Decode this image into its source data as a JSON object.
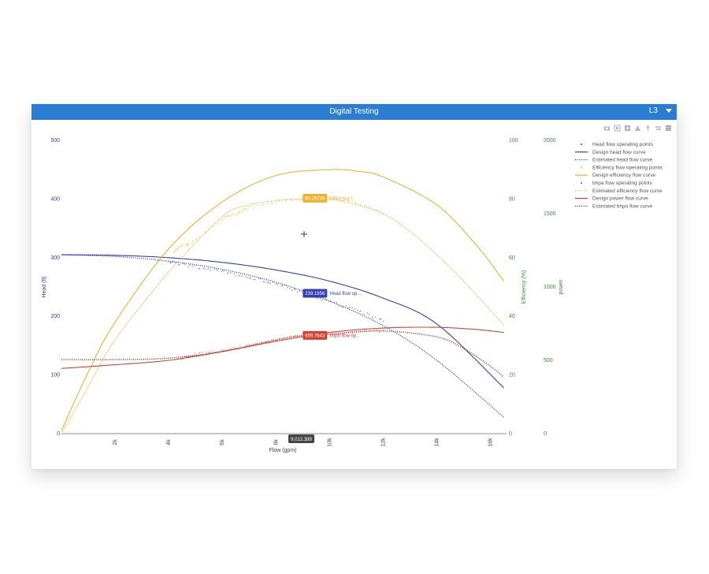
{
  "header": {
    "title": "Digital Testing",
    "selector_value": "L3"
  },
  "modebar": [
    "camera-icon",
    "zoom-icon",
    "pan-icon",
    "autoscale-icon",
    "spike-icon",
    "compare-icon",
    "menu-icon"
  ],
  "colors": {
    "header": "#2a7dd1",
    "blue": "#3340b0",
    "orange": "#f2b030",
    "red": "#d64232",
    "green": "#3d8a3d"
  },
  "cursor": {
    "x_readout": "9,012.389"
  },
  "chart_data": {
    "type": "line",
    "xlabel": "Flow (gpm)",
    "xlim": [
      0,
      16600
    ],
    "x_ticks": [
      "2k",
      "4k",
      "6k",
      "8k",
      "10k",
      "12k",
      "14k",
      "16k"
    ],
    "x_tick_values": [
      2000,
      4000,
      6000,
      8000,
      10000,
      12000,
      14000,
      16000
    ],
    "axes": {
      "head": {
        "label": "Head (ft)",
        "range": [
          0,
          500
        ],
        "ticks": [
          "0",
          "100",
          "200",
          "300",
          "400",
          "500"
        ],
        "tick_values": [
          0,
          100,
          200,
          300,
          400,
          500
        ]
      },
      "efficiency": {
        "label": "Efficiency (%)",
        "range": [
          0,
          100
        ],
        "ticks": [
          "0",
          "20",
          "40",
          "60",
          "80",
          "100"
        ],
        "tick_values": [
          0,
          20,
          40,
          60,
          80,
          100
        ]
      },
      "power": {
        "label": "power",
        "range": [
          0,
          2000
        ],
        "ticks": [
          "0",
          "500",
          "1000",
          "1500",
          "2000"
        ],
        "tick_values": [
          0,
          500,
          1000,
          1500,
          2000
        ]
      }
    },
    "legend_position": "top-right",
    "series": [
      {
        "name": "Head flow operating points",
        "axis": "head",
        "style": "markers",
        "color": "#3340b0",
        "x": [
          4000,
          5000,
          6000,
          7000,
          8000,
          9000,
          10000,
          11000,
          12000
        ],
        "y": [
          293,
          284,
          276,
          266,
          255,
          240,
          225,
          210,
          193
        ]
      },
      {
        "name": "Design head flow curve",
        "axis": "head",
        "style": "solid",
        "color": "#3340b0",
        "x": [
          0,
          2000,
          4000,
          6000,
          8000,
          10000,
          12000,
          14000,
          16500
        ],
        "y": [
          305,
          304,
          300,
          292,
          279,
          260,
          231,
          187,
          78
        ]
      },
      {
        "name": "Estimated head flow curve",
        "axis": "head",
        "style": "dotted",
        "color": "#3340b0",
        "x": [
          0,
          2000,
          4000,
          6000,
          8000,
          10000,
          12000,
          14000,
          16500
        ],
        "y": [
          305,
          302,
          294,
          280,
          258,
          226,
          184,
          125,
          28
        ]
      },
      {
        "name": "Efficiency flow operating points",
        "axis": "efficiency",
        "style": "markers",
        "color": "#f2b030",
        "x": [
          4200,
          4500,
          5000,
          6000,
          6500,
          7000,
          8000,
          9000,
          10000,
          11000,
          12000
        ],
        "y": [
          62,
          64,
          66,
          73,
          75,
          77,
          79,
          80,
          80,
          79,
          75
        ]
      },
      {
        "name": "Design efficiency flow curve",
        "axis": "efficiency",
        "style": "solid",
        "color": "#f2b030",
        "x": [
          0,
          1000,
          2000,
          4000,
          6000,
          8000,
          10000,
          11000,
          12000,
          14000,
          15500,
          16500
        ],
        "y": [
          1,
          21,
          38,
          63,
          79,
          88,
          90,
          89.5,
          87.5,
          78,
          64,
          52
        ]
      },
      {
        "name": "bhpa flow operating points",
        "axis": "power",
        "style": "markers",
        "color": "#d64232",
        "x": [
          4500,
          5000,
          6000,
          7000,
          8000,
          9000,
          10000,
          11000,
          12000
        ],
        "y": [
          515,
          540,
          570,
          600,
          640,
          668,
          680,
          690,
          700
        ]
      },
      {
        "name": "Estimated efficiency flow curve",
        "axis": "efficiency",
        "style": "dotted",
        "color": "#f2b030",
        "x": [
          0,
          1000,
          2000,
          4000,
          6000,
          7000,
          8000,
          9000,
          10000,
          11000,
          12000,
          13000,
          14000,
          15000,
          16500
        ],
        "y": [
          0,
          16,
          32,
          55,
          74,
          78,
          79.5,
          80,
          80,
          78,
          75,
          69,
          61,
          52,
          37
        ]
      },
      {
        "name": "Design power flow curve",
        "axis": "power",
        "style": "solid",
        "color": "#d64232",
        "x": [
          0,
          2000,
          4000,
          6000,
          8000,
          10000,
          12000,
          14000,
          15500,
          16500
        ],
        "y": [
          445,
          470,
          500,
          560,
          630,
          690,
          720,
          725,
          710,
          690
        ]
      },
      {
        "name": "Estimated bhpa flow curve",
        "axis": "power",
        "style": "dotted",
        "color": "#8b1a1a",
        "x": [
          0,
          2000,
          4000,
          6000,
          8000,
          9000,
          10000,
          12000,
          14000,
          15000,
          16000,
          16500
        ],
        "y": [
          505,
          505,
          515,
          560,
          640,
          670,
          680,
          700,
          660,
          580,
          460,
          385
        ]
      }
    ],
    "annotations": [
      {
        "label": "80.26239",
        "text": "Efficiency f...",
        "axis": "efficiency",
        "x": 9000,
        "y": 80.26,
        "color": "#f2b030"
      },
      {
        "label": "239.1856",
        "text": "Head flow op...",
        "axis": "head",
        "x": 9000,
        "y": 239.19,
        "color": "#3340b0"
      },
      {
        "label": "669.7643",
        "text": "bhpa flow op...",
        "axis": "power",
        "x": 9000,
        "y": 669.76,
        "color": "#d64232"
      }
    ]
  }
}
